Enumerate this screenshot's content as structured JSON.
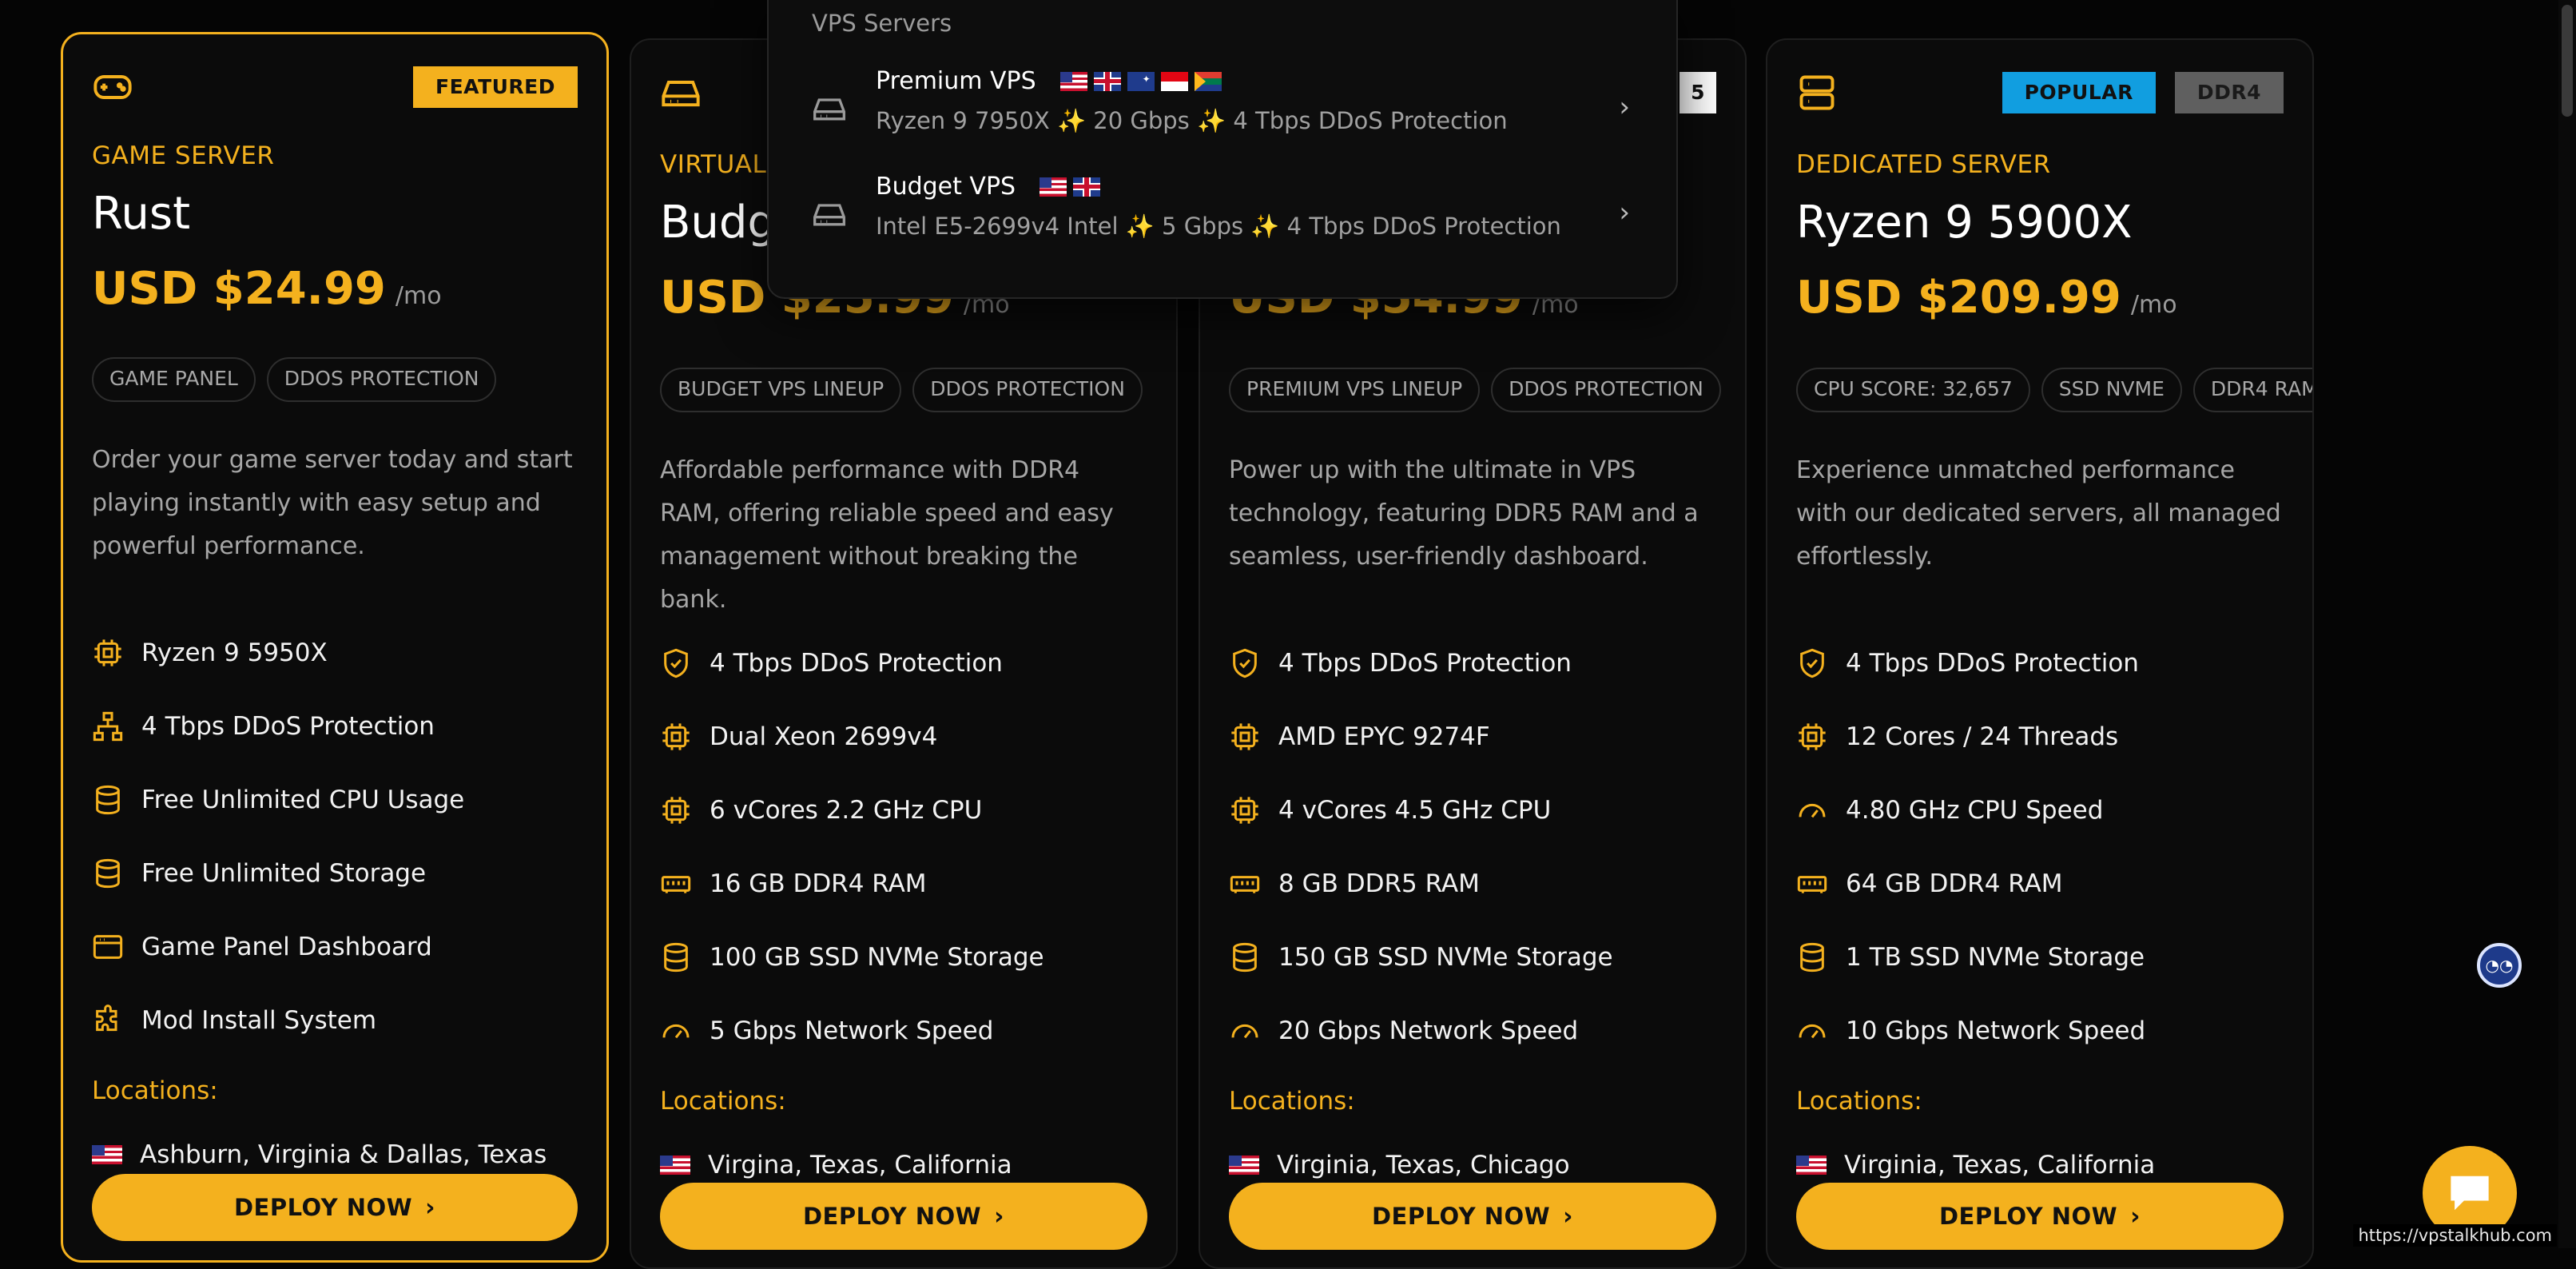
{
  "accent_color": "#f4b11e",
  "plans": [
    {
      "icon": "gamepad-icon",
      "badges": [
        {
          "label": "FEATURED",
          "style": "yellow"
        }
      ],
      "category": "GAME SERVER",
      "name": "Rust",
      "price": "USD $24.99",
      "period": "/mo",
      "tags": [
        "GAME PANEL",
        "DDOS PROTECTION"
      ],
      "description": "Order your game server today and start playing instantly with easy setup and powerful performance.",
      "features": [
        {
          "icon": "cpu-icon",
          "text": "Ryzen 9 5950X"
        },
        {
          "icon": "network-icon",
          "text": "4 Tbps DDoS Protection"
        },
        {
          "icon": "database-icon",
          "text": "Free Unlimited CPU Usage"
        },
        {
          "icon": "database-icon",
          "text": "Free Unlimited Storage"
        },
        {
          "icon": "browser-window-icon",
          "text": "Game Panel Dashboard"
        },
        {
          "icon": "puzzle-icon",
          "text": "Mod Install System"
        }
      ],
      "locations_label": "Locations:",
      "location": "Ashburn, Virginia & Dallas, Texas",
      "cta": "DEPLOY NOW"
    },
    {
      "icon": "hard-drive-icon",
      "badges": [],
      "category": "VIRTUAL",
      "name": "Budg",
      "price": "USD $25.99",
      "period": "/mo",
      "tags": [
        "BUDGET VPS LINEUP",
        "DDOS PROTECTION"
      ],
      "description": "Affordable performance with DDR4 RAM, offering reliable speed and easy management without breaking the bank.",
      "features": [
        {
          "icon": "shield-check-icon",
          "text": "4 Tbps DDoS Protection"
        },
        {
          "icon": "cpu-icon",
          "text": "Dual Xeon 2699v4"
        },
        {
          "icon": "cpu-icon",
          "text": "6 vCores 2.2 GHz CPU"
        },
        {
          "icon": "memory-icon",
          "text": "16 GB DDR4 RAM"
        },
        {
          "icon": "database-icon",
          "text": "100 GB SSD NVMe Storage"
        },
        {
          "icon": "gauge-icon",
          "text": "5 Gbps Network Speed"
        }
      ],
      "locations_label": "Locations:",
      "location": "Virgina, Texas, California",
      "cta": "DEPLOY NOW"
    },
    {
      "icon": "hard-drive-icon",
      "badges": [
        {
          "label": "5",
          "style": "white"
        }
      ],
      "category": "",
      "name": "",
      "price": "USD $54.99",
      "period": "/mo",
      "tags": [
        "PREMIUM VPS LINEUP",
        "DDOS PROTECTION"
      ],
      "description": "Power up with the ultimate in VPS technology, featuring DDR5 RAM and a seamless, user-friendly dashboard.",
      "features": [
        {
          "icon": "shield-check-icon",
          "text": "4 Tbps DDoS Protection"
        },
        {
          "icon": "cpu-icon",
          "text": "AMD EPYC 9274F"
        },
        {
          "icon": "cpu-icon",
          "text": "4 vCores 4.5 GHz CPU"
        },
        {
          "icon": "memory-icon",
          "text": "8 GB DDR5 RAM"
        },
        {
          "icon": "database-icon",
          "text": "150 GB SSD NVMe Storage"
        },
        {
          "icon": "gauge-icon",
          "text": "20 Gbps Network Speed"
        }
      ],
      "locations_label": "Locations:",
      "location": "Virginia, Texas, Chicago",
      "cta": "DEPLOY NOW"
    },
    {
      "icon": "server-icon",
      "badges": [
        {
          "label": "POPULAR",
          "style": "blue"
        },
        {
          "label": "DDR4",
          "style": "gray"
        }
      ],
      "category": "DEDICATED SERVER",
      "name": "Ryzen 9 5900X",
      "price": "USD $209.99",
      "period": "/mo",
      "tags": [
        "CPU SCORE: 32,657",
        "SSD NVME",
        "DDR4 RAM"
      ],
      "description": "Experience unmatched performance with our dedicated servers, all managed effortlessly.",
      "features": [
        {
          "icon": "shield-check-icon",
          "text": "4 Tbps DDoS Protection"
        },
        {
          "icon": "cpu-icon",
          "text": "12 Cores / 24 Threads"
        },
        {
          "icon": "gauge-icon",
          "text": "4.80 GHz CPU Speed"
        },
        {
          "icon": "memory-icon",
          "text": "64 GB DDR4 RAM"
        },
        {
          "icon": "database-icon",
          "text": "1 TB SSD NVMe Storage"
        },
        {
          "icon": "gauge-icon",
          "text": "10 Gbps Network Speed"
        }
      ],
      "locations_label": "Locations:",
      "location": "Virginia, Texas, California",
      "cta": "DEPLOY NOW"
    }
  ],
  "dropdown": {
    "title": "VPS Servers",
    "items": [
      {
        "name": "Premium VPS",
        "flags": [
          "us",
          "gb",
          "au",
          "sg",
          "za"
        ],
        "sub": "Ryzen 9 7950X ✨ 20 Gbps ✨ 4 Tbps DDoS Protection"
      },
      {
        "name": "Budget VPS",
        "flags": [
          "us",
          "gb"
        ],
        "sub": "Intel E5-2699v4 Intel ✨ 5 Gbps ✨ 4 Tbps DDoS Protection"
      }
    ]
  },
  "status_url": "https://vpstalkhub.com"
}
